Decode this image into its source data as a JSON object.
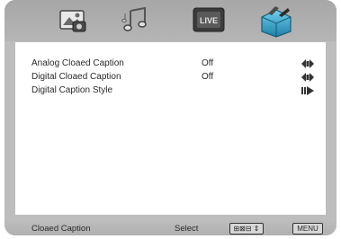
{
  "tabs": [
    {
      "icon": "picture-settings-icon",
      "active": false
    },
    {
      "icon": "music-notes-icon",
      "active": false
    },
    {
      "icon": "live-tv-icon",
      "label": "LIVE",
      "active": false
    },
    {
      "icon": "setup-toolbox-icon",
      "active": true
    }
  ],
  "menu": {
    "items": [
      {
        "label": "Analog Cloaed Caption",
        "value": "Off",
        "control": "left-right-arrows-icon"
      },
      {
        "label": "Digital Cloaed Caption",
        "value": "Off",
        "control": "left-right-arrows-icon"
      },
      {
        "label": "Digital Caption Style",
        "value": "",
        "control": "enter-arrow-icon"
      }
    ]
  },
  "footer": {
    "title": "Cloaed Caption",
    "select_label": "Select",
    "nav_key_label": "⊞⊠⊟ ⇕",
    "menu_key_label": "MENU"
  },
  "colors": {
    "frame": "#bdbdbd",
    "panel": "#ffffff",
    "accent_active_tab": "#2f8fb0",
    "text": "#2a2a2a"
  }
}
